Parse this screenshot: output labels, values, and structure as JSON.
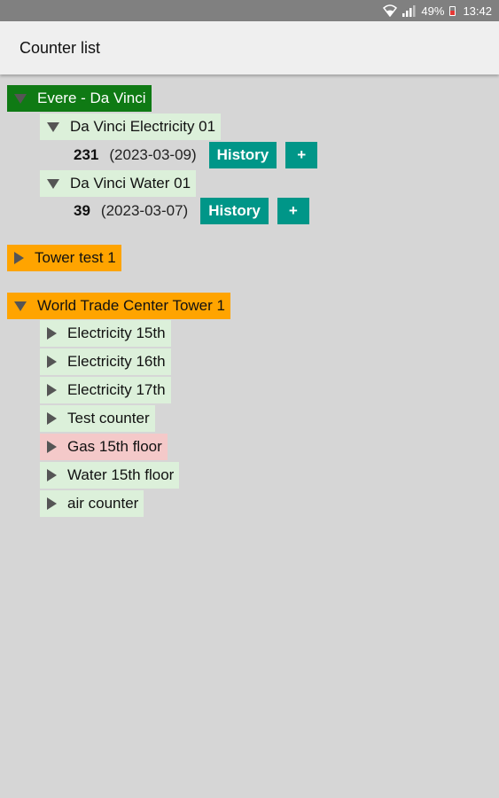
{
  "status_bar": {
    "battery": "49%",
    "time": "13:42",
    "icons": [
      "wifi-icon",
      "signal-icon",
      "battery-icon"
    ]
  },
  "app_bar": {
    "title": "Counter list"
  },
  "colors": {
    "site_open": "#0f7a14",
    "site_closed": "#ffa400",
    "counter_ok": "#dcf0da",
    "counter_alert": "#f4c9c9",
    "button": "#009688"
  },
  "tree": {
    "sites": [
      {
        "label": "Evere - Da Vinci",
        "expanded": true,
        "counters": [
          {
            "label": "Da Vinci Electricity 01",
            "expanded": true,
            "value": "231",
            "date": "(2023-03-09)",
            "history_label": "History",
            "add_label": "+"
          },
          {
            "label": "Da Vinci Water 01",
            "expanded": true,
            "value": "39",
            "date": "(2023-03-07)",
            "history_label": "History",
            "add_label": "+"
          }
        ]
      },
      {
        "label": "Tower test 1",
        "expanded": false,
        "counters": []
      },
      {
        "label": "World Trade Center Tower 1",
        "expanded": true,
        "counters": [
          {
            "label": "Electricity 15th",
            "expanded": false
          },
          {
            "label": "Electricity 16th",
            "expanded": false
          },
          {
            "label": "Electricity 17th",
            "expanded": false
          },
          {
            "label": "Test counter",
            "expanded": false
          },
          {
            "label": "Gas 15th floor",
            "expanded": false
          },
          {
            "label": "Water 15th floor",
            "expanded": false
          },
          {
            "label": "air counter",
            "expanded": false
          }
        ]
      }
    ]
  }
}
